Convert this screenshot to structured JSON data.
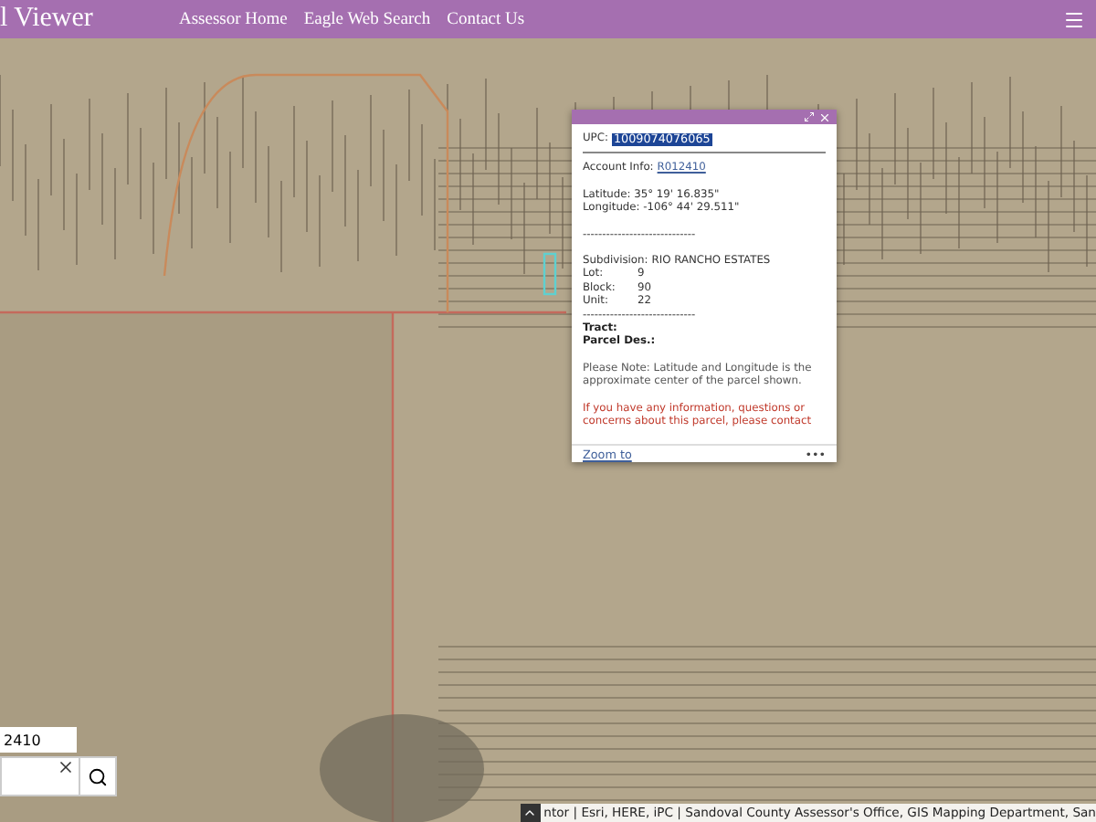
{
  "header": {
    "title": "l Viewer",
    "nav_links": [
      "Assessor Home",
      "Eagle Web Search",
      "Contact Us"
    ]
  },
  "popup": {
    "upc_label": "UPC:",
    "upc_value": "1009074076065",
    "account_label": "Account Info:",
    "account_link": "R012410",
    "latitude": "Latitude: 35° 19' 16.835\"",
    "longitude": "Longitude: -106° 44' 29.511\"",
    "separators": [
      "-----------------------------",
      "-----------------------------"
    ],
    "fields": [
      {
        "label": "Subdivision:",
        "value": "RIO RANCHO ESTATES"
      },
      {
        "label": "Lot:",
        "value": "9"
      },
      {
        "label": "Block:",
        "value": "90"
      },
      {
        "label": "Unit:",
        "value": "22"
      }
    ],
    "extra_fields": [
      "Tract:",
      "Parcel Des.:"
    ],
    "note": "Please Note: Latitude and Longitude is the approximate center of the parcel shown.",
    "warning": "If you have any information, questions or concerns about this parcel, please contact",
    "zoom_link": "Zoom to",
    "menu": "•••"
  },
  "search": {
    "value": "2410"
  },
  "attribution": "ntor | Esri, HERE, iPC | Sandoval County Assessor's Office, GIS Mapping Department, San"
}
